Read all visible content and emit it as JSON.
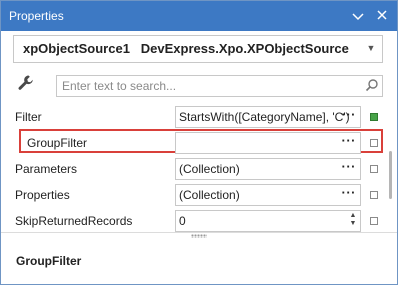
{
  "window": {
    "title": "Properties"
  },
  "selector": {
    "value": "xpObjectSource1   DevExpress.Xpo.XPObjectSource"
  },
  "search": {
    "placeholder": "Enter text to search..."
  },
  "properties": [
    {
      "name": "Filter",
      "value": "StartsWith([CategoryName], 'C')",
      "editor": "ellipsis",
      "modified": true
    },
    {
      "name": "GroupFilter",
      "value": "",
      "editor": "ellipsis",
      "modified": false,
      "highlighted": true
    },
    {
      "name": "Parameters",
      "value": "(Collection)",
      "editor": "ellipsis",
      "modified": false
    },
    {
      "name": "Properties",
      "value": "(Collection)",
      "editor": "ellipsis",
      "modified": false
    },
    {
      "name": "SkipReturnedRecords",
      "value": "0",
      "editor": "spin",
      "modified": false
    }
  ],
  "description": {
    "title": "GroupFilter"
  },
  "colors": {
    "titlebar": "#3d79c4",
    "highlight": "#d9403a",
    "modified_marker": "#47a348"
  }
}
